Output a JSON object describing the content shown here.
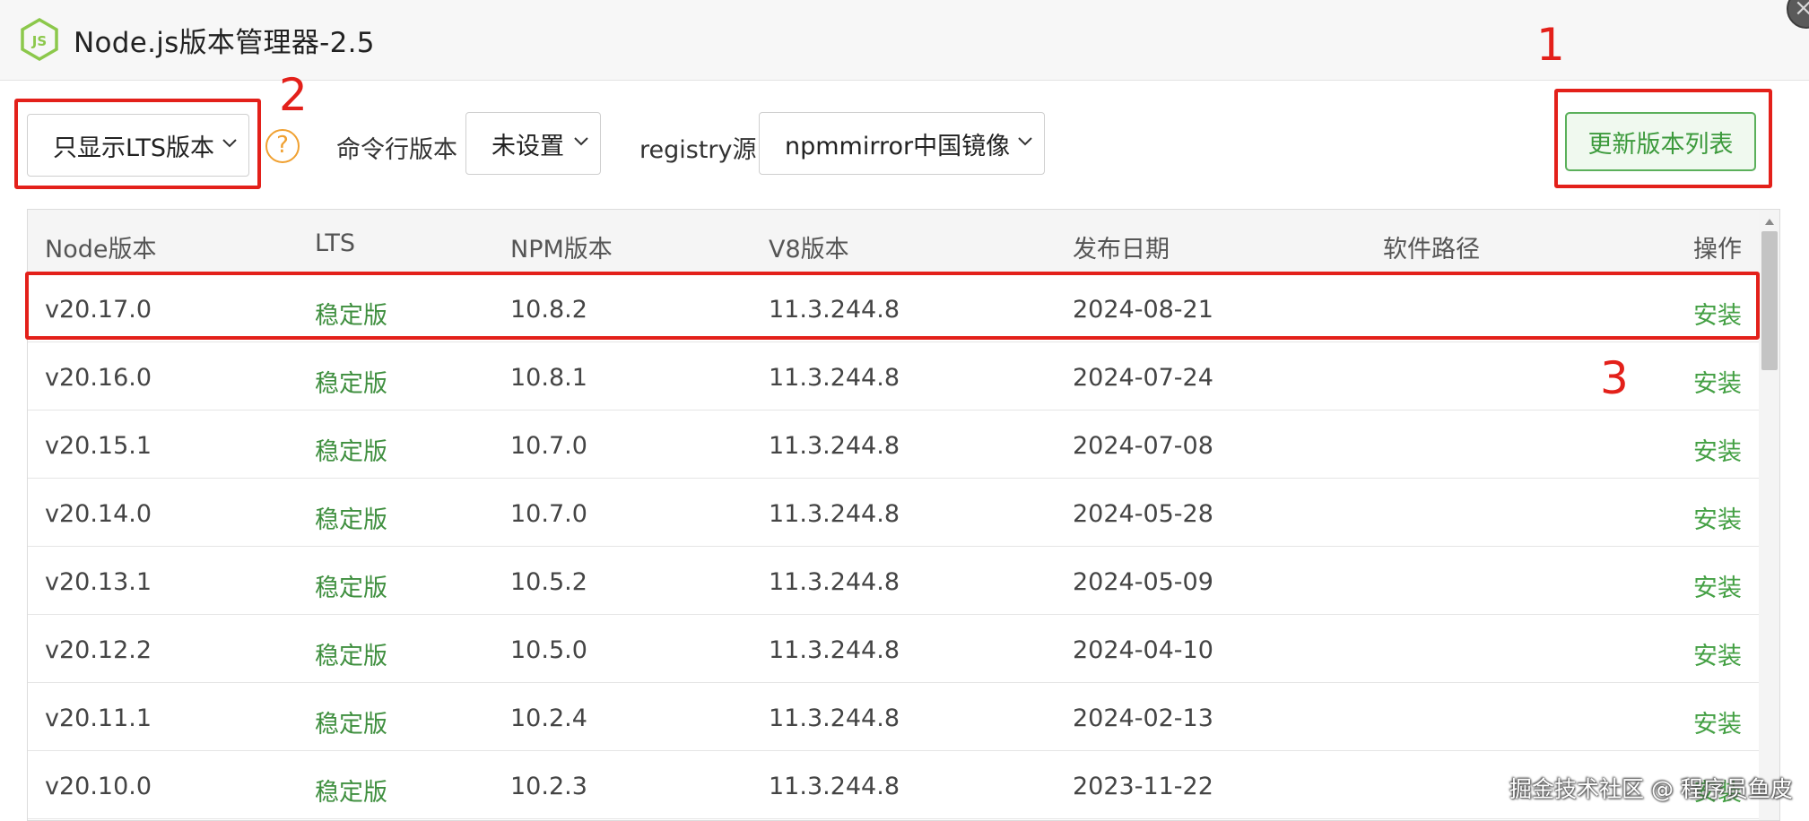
{
  "window": {
    "title": "Node.js版本管理器-2.5",
    "logo_icon": "nodejs-hexagon-icon",
    "logo_text": "JS"
  },
  "toolbar": {
    "filter_select": "只显示LTS版本",
    "help_glyph": "?",
    "cli_label": "命令行版本",
    "cli_select": "未设置",
    "registry_label": "registry源",
    "registry_select": "npmmirror中国镜像",
    "update_button": "更新版本列表"
  },
  "annotations": [
    "1",
    "2",
    "3"
  ],
  "table": {
    "headers": [
      "Node版本",
      "LTS",
      "NPM版本",
      "V8版本",
      "发布日期",
      "软件路径",
      "操作"
    ],
    "rows": [
      {
        "node": "v20.17.0",
        "lts": "稳定版",
        "npm": "10.8.2",
        "v8": "11.3.244.8",
        "date": "2024-08-21",
        "path": "",
        "action": "安装"
      },
      {
        "node": "v20.16.0",
        "lts": "稳定版",
        "npm": "10.8.1",
        "v8": "11.3.244.8",
        "date": "2024-07-24",
        "path": "",
        "action": "安装"
      },
      {
        "node": "v20.15.1",
        "lts": "稳定版",
        "npm": "10.7.0",
        "v8": "11.3.244.8",
        "date": "2024-07-08",
        "path": "",
        "action": "安装"
      },
      {
        "node": "v20.14.0",
        "lts": "稳定版",
        "npm": "10.7.0",
        "v8": "11.3.244.8",
        "date": "2024-05-28",
        "path": "",
        "action": "安装"
      },
      {
        "node": "v20.13.1",
        "lts": "稳定版",
        "npm": "10.5.2",
        "v8": "11.3.244.8",
        "date": "2024-05-09",
        "path": "",
        "action": "安装"
      },
      {
        "node": "v20.12.2",
        "lts": "稳定版",
        "npm": "10.5.0",
        "v8": "11.3.244.8",
        "date": "2024-04-10",
        "path": "",
        "action": "安装"
      },
      {
        "node": "v20.11.1",
        "lts": "稳定版",
        "npm": "10.2.4",
        "v8": "11.3.244.8",
        "date": "2024-02-13",
        "path": "",
        "action": "安装"
      },
      {
        "node": "v20.10.0",
        "lts": "稳定版",
        "npm": "10.2.3",
        "v8": "11.3.244.8",
        "date": "2023-11-22",
        "path": "",
        "action": "安装"
      }
    ]
  },
  "watermark": "掘金技术社区 @ 程序员鱼皮",
  "colors": {
    "accent_green": "#44a044",
    "annotation_red": "#e3201a",
    "help_orange": "#f0a030"
  }
}
